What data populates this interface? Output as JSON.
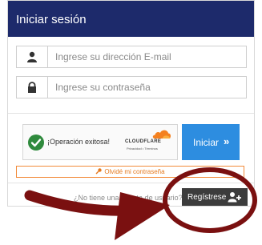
{
  "header": {
    "title": "Iniciar sesión"
  },
  "form": {
    "email_placeholder": "Ingrese su dirección E-mail",
    "password_placeholder": "Ingrese su contraseña"
  },
  "captcha": {
    "status": "¡Operación exitosa!",
    "provider": "CLOUDFLARE",
    "links": "Privacidad • Términos"
  },
  "buttons": {
    "login_label": "Iniciar",
    "forgot_label": "Olvidé mi contraseña",
    "register_label": "Regístrese"
  },
  "footer": {
    "no_account_text": "¿No tiene una cuenta de usuario?"
  },
  "annotations": {
    "color": "#7a1010"
  },
  "icons": [
    "user-icon",
    "lock-icon",
    "check-icon",
    "cloudflare-logo-icon",
    "chevron-double-right-icon",
    "key-icon",
    "add-user-icon",
    "arrow-annotation",
    "circle-annotation"
  ]
}
